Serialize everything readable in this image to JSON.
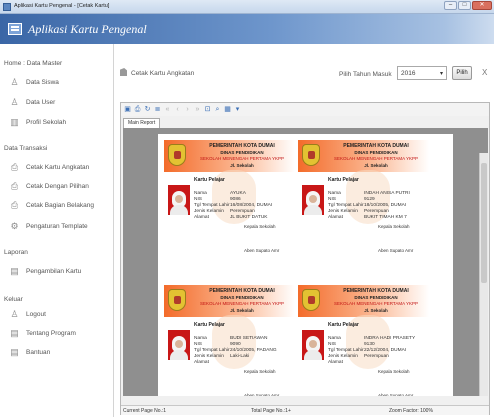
{
  "window": {
    "title": "Aplikasi Kartu Pengenal - [Cetak Kartu]"
  },
  "app": {
    "title": "Aplikasi Kartu Pengenal"
  },
  "sidebar": {
    "master_title": "Home : Data Master",
    "master_items": [
      {
        "label": "Data Siswa",
        "icon": "person-icon"
      },
      {
        "label": "Data User",
        "icon": "person-icon"
      },
      {
        "label": "Profil Sekolah",
        "icon": "building-icon"
      }
    ],
    "transaksi_title": "Data Transaksi",
    "transaksi_items": [
      {
        "label": "Cetak Kartu Angkatan",
        "icon": "printer-icon"
      },
      {
        "label": "Cetak Dengan Pilihan",
        "icon": "printer-icon"
      },
      {
        "label": "Cetak Bagian Belakang",
        "icon": "printer-icon"
      },
      {
        "label": "Pengaturan Template",
        "icon": "settings-icon"
      }
    ],
    "laporan_title": "Laporan",
    "laporan_items": [
      {
        "label": "Pengambilan Kartu",
        "icon": "document-icon"
      }
    ],
    "keluar_title": "Keluar",
    "keluar_items": [
      {
        "label": "Logout",
        "icon": "person-icon"
      },
      {
        "label": "Tentang Program",
        "icon": "document-icon"
      },
      {
        "label": "Bantuan",
        "icon": "document-icon"
      }
    ]
  },
  "content": {
    "title": "Cetak Kartu Angkatan",
    "year_label": "Pilih Tahun Masuk",
    "year_value": "2016",
    "pilih_label": "Pilih",
    "close_label": "X"
  },
  "viewer": {
    "tab": "Main Report",
    "status_page": "Current Page No.:1",
    "status_total": "Total Page No.:1+",
    "status_zoom": "Zoom Factor: 100%"
  },
  "card_header": {
    "line1": "PEMERINTAH KOTA DUMAI",
    "line2": "DINAS PENDIDIKAN",
    "line3": "SEKOLAH MENENGAH PERTAMA YKPP",
    "line4": "Jl. Sekolah"
  },
  "card_labels": {
    "kartu": "Kartu Pelajar",
    "nama": "Nama",
    "nis": "NIS",
    "ttl": "Tgl Tempat Lahir",
    "jk": "Jenis Kelamin",
    "alamat": "Alamat",
    "sign_title": "Kepala Sekolah",
    "sign_name": "Aben Supato Amr"
  },
  "cards": [
    {
      "nama": "AYUKA",
      "nis": "9086",
      "ttl": "16/08/2004, DUMAI",
      "jk": "Perempuan",
      "alamat": "JL BUKIT DATUK"
    },
    {
      "nama": "INDAH ANISA PUTRI",
      "nis": "9129",
      "ttl": "18/10/2005, DUMAI",
      "jk": "Perempuan",
      "alamat": "BUKIT TIMAH KM 7"
    },
    {
      "nama": "BUDI SETIAWAN",
      "nis": "9090",
      "ttl": "24/10/2005, PADANG",
      "jk": "Laki-Laki",
      "alamat": ""
    },
    {
      "nama": "INDRA HADI PRASETY",
      "nis": "9130",
      "ttl": "22/12/2004, DUMAI",
      "jk": "Perempuan",
      "alamat": ""
    }
  ]
}
